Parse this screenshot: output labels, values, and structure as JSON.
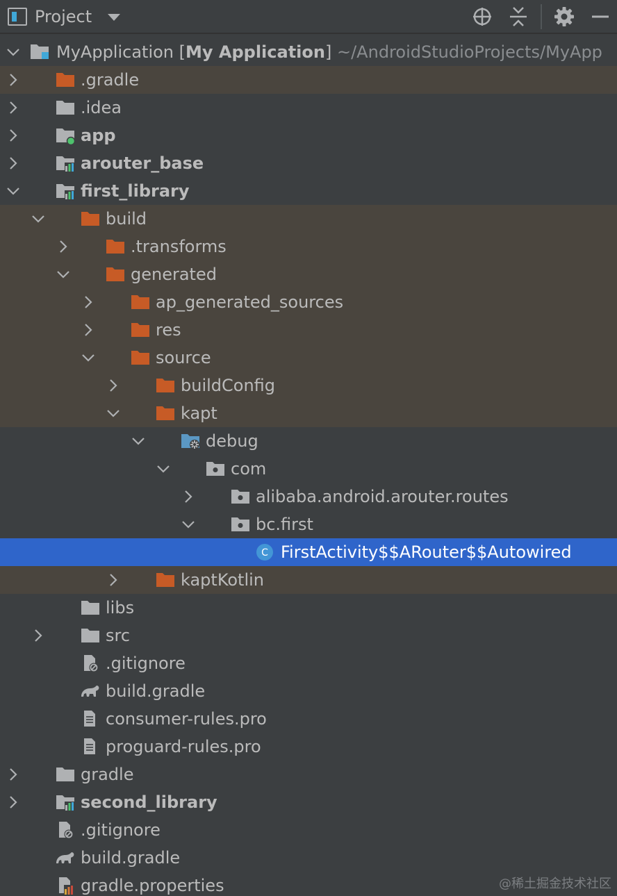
{
  "header": {
    "title": "Project",
    "buttons": [
      "locate-icon",
      "collapse-all-icon",
      "gear-icon",
      "minimize-icon"
    ]
  },
  "tree": {
    "root": {
      "name": "MyApplication",
      "bracket_open": " [",
      "module": "My Application",
      "bracket_close": "]",
      "path": " ~/AndroidStudioProjects/MyApp"
    },
    "items": [
      {
        "label": ".gradle",
        "state": "collapsed",
        "icon": "folder-excluded-icon",
        "excluded": true
      },
      {
        "label": ".idea",
        "state": "collapsed",
        "icon": "folder-icon"
      },
      {
        "label": "app",
        "state": "collapsed",
        "icon": "app-module-icon",
        "bold": true
      },
      {
        "label": "arouter_base",
        "state": "collapsed",
        "icon": "library-module-icon",
        "bold": true
      },
      {
        "label": "first_library",
        "state": "expanded",
        "icon": "library-module-icon",
        "bold": true
      },
      {
        "label": "build",
        "state": "expanded",
        "icon": "folder-excluded-icon",
        "excluded": true
      },
      {
        "label": ".transforms",
        "state": "collapsed",
        "icon": "folder-excluded-icon",
        "excluded": true
      },
      {
        "label": "generated",
        "state": "expanded",
        "icon": "folder-excluded-icon",
        "excluded": true
      },
      {
        "label": "ap_generated_sources",
        "state": "collapsed",
        "icon": "folder-excluded-icon",
        "excluded": true
      },
      {
        "label": "res",
        "state": "collapsed",
        "icon": "folder-excluded-icon",
        "excluded": true
      },
      {
        "label": "source",
        "state": "expanded",
        "icon": "folder-excluded-icon",
        "excluded": true
      },
      {
        "label": "buildConfig",
        "state": "collapsed",
        "icon": "folder-excluded-icon",
        "excluded": true
      },
      {
        "label": "kapt",
        "state": "expanded",
        "icon": "folder-excluded-icon",
        "excluded": true
      },
      {
        "label": "debug",
        "state": "expanded",
        "icon": "generated-source-folder-icon"
      },
      {
        "label": "com",
        "state": "expanded",
        "icon": "package-icon"
      },
      {
        "label": "alibaba.android.arouter.routes",
        "state": "collapsed",
        "icon": "package-icon"
      },
      {
        "label": "bc.first",
        "state": "expanded",
        "icon": "package-icon"
      },
      {
        "label": "FirstActivity$$ARouter$$Autowired",
        "state": "leaf",
        "icon": "class-icon",
        "selected": true
      },
      {
        "label": "kaptKotlin",
        "state": "collapsed",
        "icon": "folder-excluded-icon",
        "excluded": true
      },
      {
        "label": "libs",
        "state": "leaf",
        "icon": "folder-icon"
      },
      {
        "label": "src",
        "state": "collapsed",
        "icon": "folder-icon"
      },
      {
        "label": ".gitignore",
        "state": "leaf",
        "icon": "ignored-file-icon"
      },
      {
        "label": "build.gradle",
        "state": "leaf",
        "icon": "gradle-icon"
      },
      {
        "label": "consumer-rules.pro",
        "state": "leaf",
        "icon": "text-file-icon"
      },
      {
        "label": "proguard-rules.pro",
        "state": "leaf",
        "icon": "text-file-icon"
      },
      {
        "label": "gradle",
        "state": "collapsed",
        "icon": "folder-icon"
      },
      {
        "label": "second_library",
        "state": "collapsed",
        "icon": "library-module-icon",
        "bold": true
      },
      {
        "label": ".gitignore",
        "state": "leaf",
        "icon": "ignored-file-icon"
      },
      {
        "label": "build.gradle",
        "state": "leaf",
        "icon": "gradle-icon"
      },
      {
        "label": "gradle.properties",
        "state": "leaf",
        "icon": "properties-file-icon"
      }
    ]
  },
  "watermark": "@稀土掘金技术社区",
  "colors": {
    "background": "#3c3f41",
    "excluded_row": "#4a453e",
    "selected_row": "#2f65ca",
    "text": "#bbbbbb",
    "excluded_folder": "#c75b26",
    "folder": "#afb1b3",
    "green_dot": "#4ec26d"
  }
}
